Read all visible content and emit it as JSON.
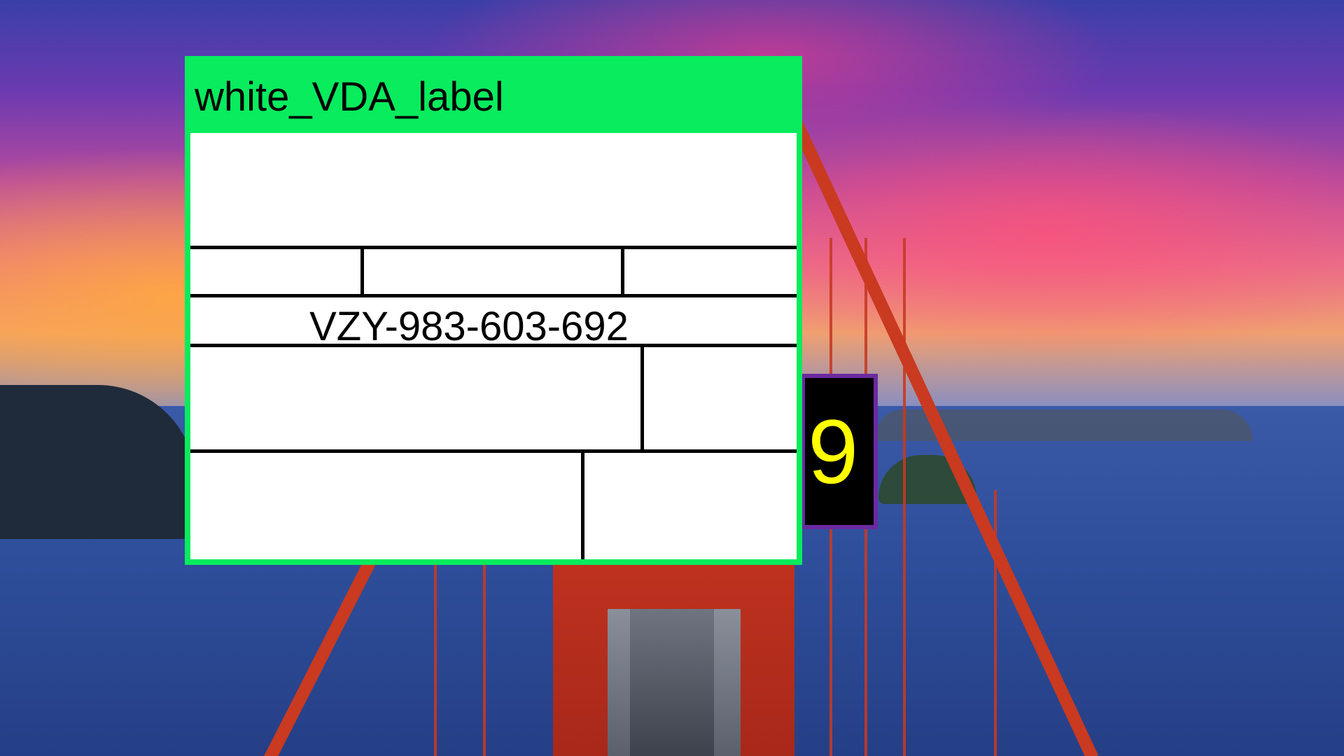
{
  "label_panel": {
    "title": "white_VDA_label",
    "tracking_code": "VZY-983-603-692",
    "accent_color": "#08ec5e"
  },
  "badge": {
    "number": "9",
    "text_color": "#ffff00",
    "border_color": "#6a2aa0"
  }
}
